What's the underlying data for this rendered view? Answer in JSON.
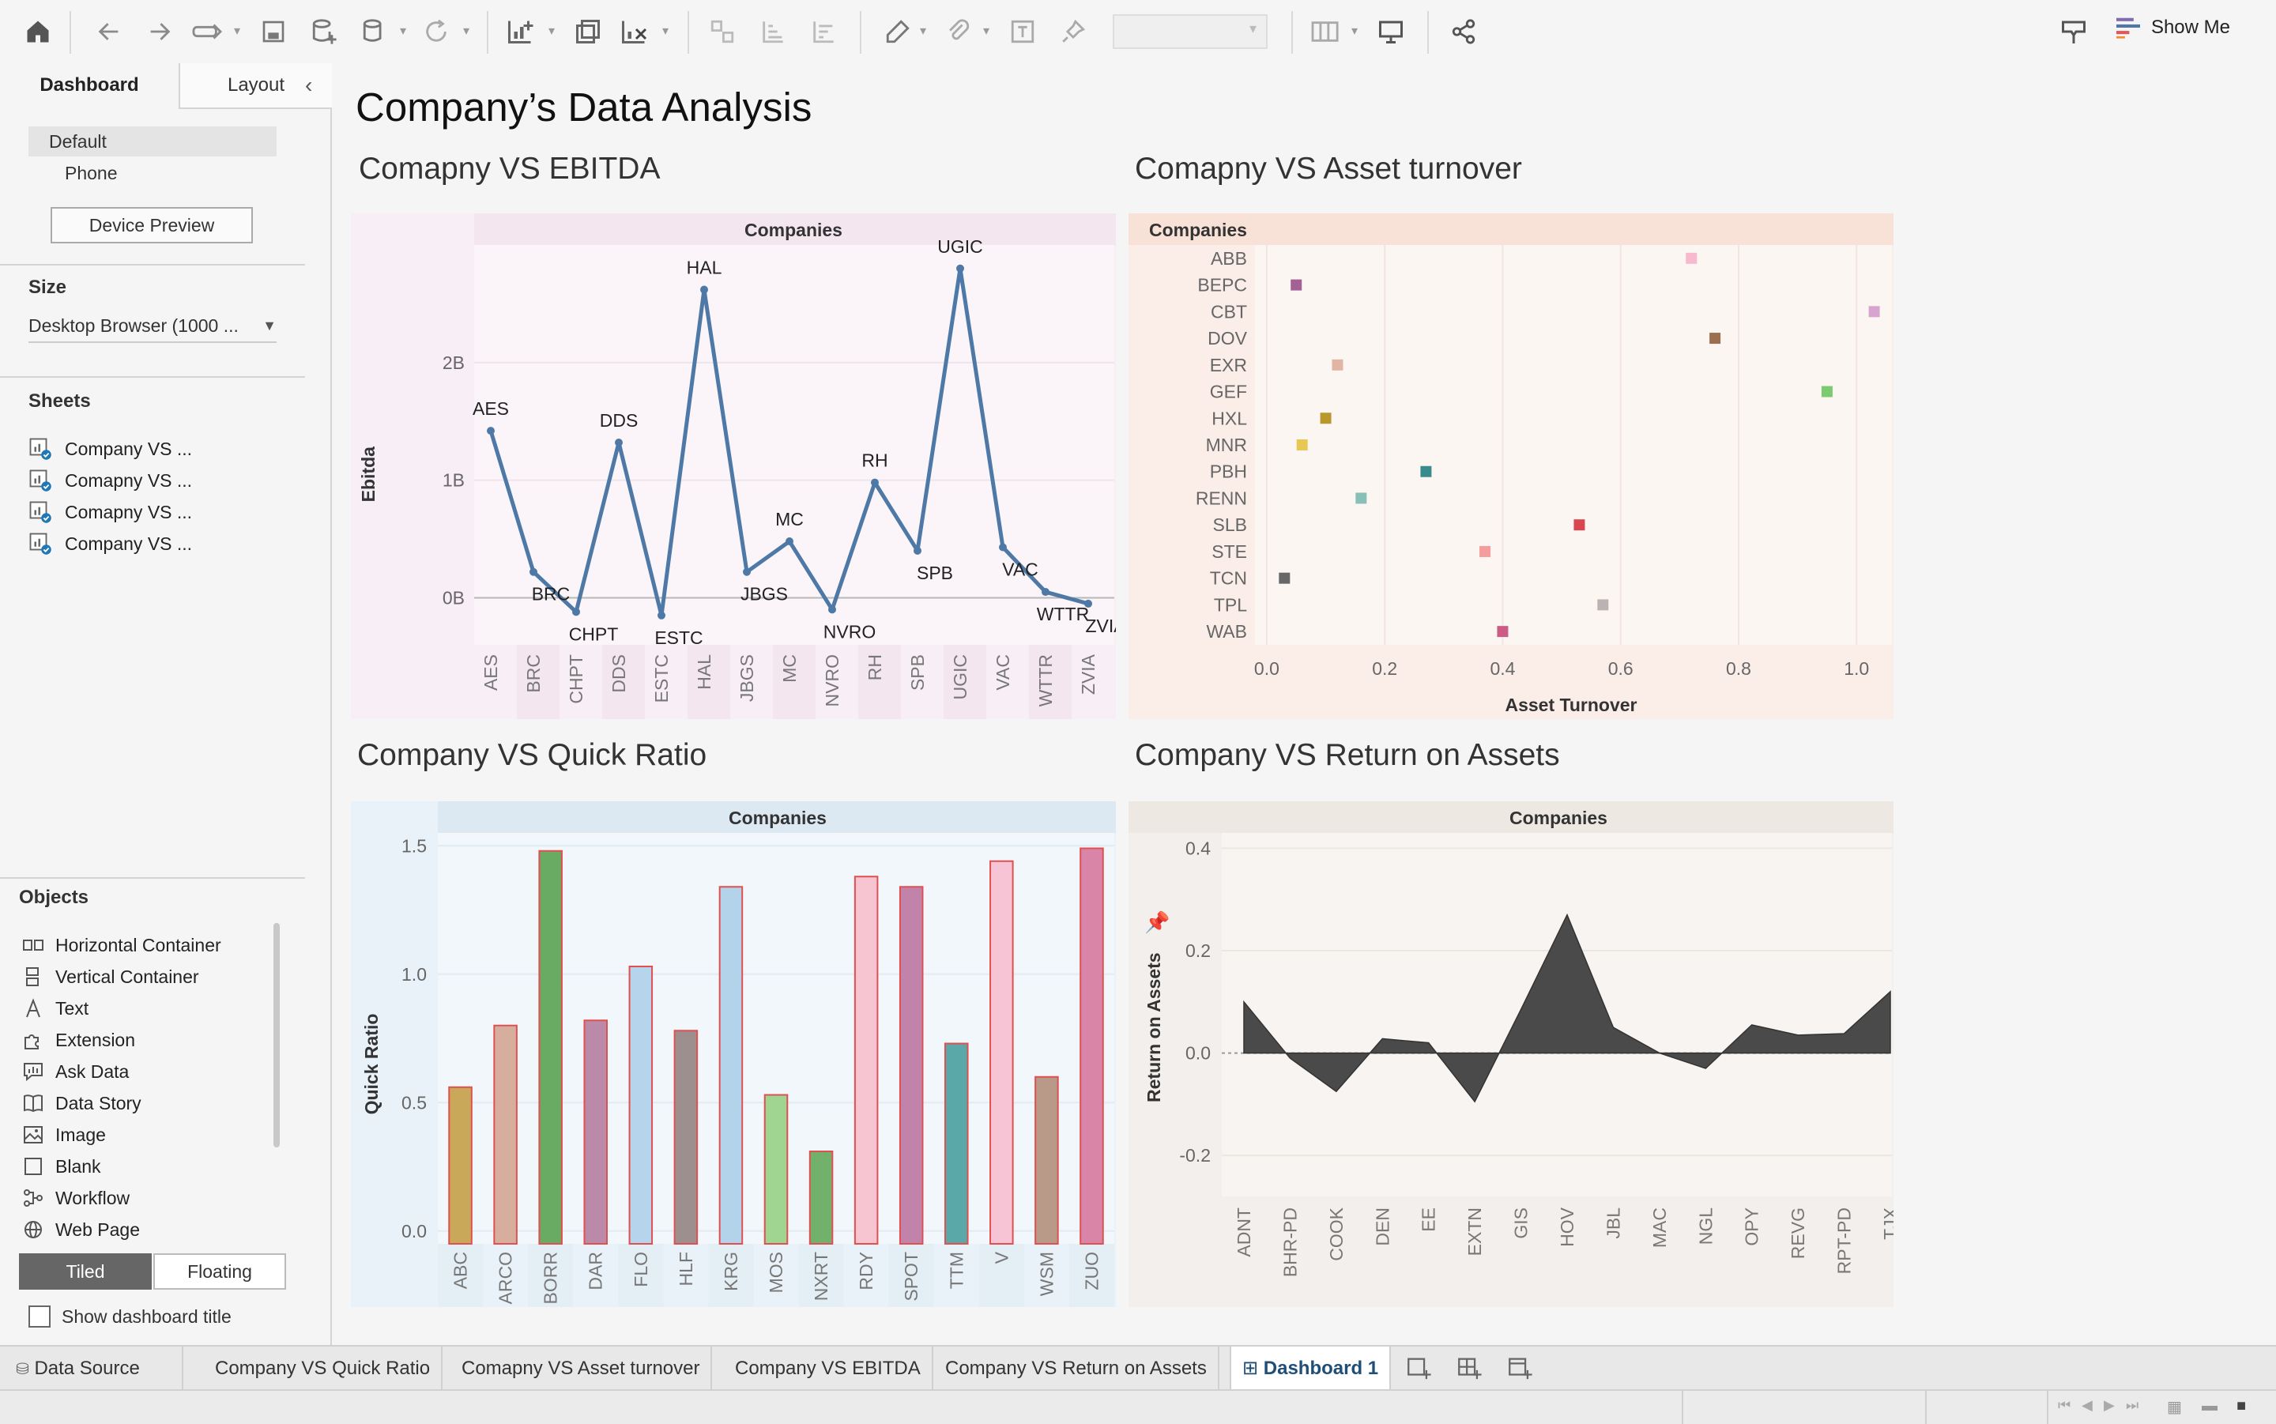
{
  "toolbar": {
    "show_me": "Show Me"
  },
  "sidebar": {
    "tab_dashboard": "Dashboard",
    "tab_layout": "Layout",
    "device_default": "Default",
    "device_phone": "Phone",
    "device_preview_button": "Device Preview",
    "size_title": "Size",
    "size_value": "Desktop Browser (1000 ...",
    "sheets_title": "Sheets",
    "sheets": [
      "Company VS ...",
      "Comapny VS ...",
      "Comapny VS ...",
      "Company VS ..."
    ],
    "objects_title": "Objects",
    "objects": [
      "Horizontal Container",
      "Vertical Container",
      "Text",
      "Extension",
      "Ask Data",
      "Data Story",
      "Image",
      "Blank",
      "Workflow",
      "Web Page"
    ],
    "tiled": "Tiled",
    "floating": "Floating",
    "show_title": "Show dashboard title"
  },
  "dashboard": {
    "title": "Company’s Data Analysis",
    "panel1_title": "Comapny VS EBITDA",
    "panel2_title": "Comapny VS Asset turnover",
    "panel3_title": "Company VS Quick Ratio",
    "panel4_title": "Company VS Return on Assets"
  },
  "bottom_tabs": [
    "Data Source",
    "Company VS Quick Ratio",
    "Comapny VS Asset turnover",
    "Company VS EBITDA",
    "Company VS Return on Assets",
    "Dashboard 1"
  ],
  "colors": {
    "line": "#4e79a7",
    "area": "#4a4a4a",
    "ebitda_bg": "#f8eef5",
    "turnover_bg": "#fbeee8",
    "quick_bg": "#e9f2f8",
    "roa_bg": "#f3efec"
  },
  "chart_data": [
    {
      "type": "line",
      "column_header": "Companies",
      "ylabel": "Ebitda",
      "yticks": [
        "0B",
        "1B",
        "2B"
      ],
      "ylim": [
        -0.4,
        3.0
      ],
      "categories": [
        "AES",
        "BRC",
        "CHPT",
        "DDS",
        "ESTC",
        "HAL",
        "JBGS",
        "MC",
        "NVRO",
        "RH",
        "SPB",
        "UGIC",
        "VAC",
        "WTTR",
        "ZVIA"
      ],
      "values": [
        1.42,
        0.22,
        -0.12,
        1.32,
        -0.15,
        2.62,
        0.22,
        0.48,
        -0.1,
        0.98,
        0.4,
        2.8,
        0.43,
        0.05,
        -0.05
      ]
    },
    {
      "type": "scatter",
      "column_header": "Companies",
      "xlabel": "Asset Turnover",
      "xticks": [
        "0.0",
        "0.2",
        "0.4",
        "0.6",
        "0.8",
        "1.0"
      ],
      "xlim": [
        -0.02,
        1.06
      ],
      "categories": [
        "ABB",
        "BEPC",
        "CBT",
        "DOV",
        "EXR",
        "GEF",
        "HXL",
        "MNR",
        "PBH",
        "RENN",
        "SLB",
        "STE",
        "TCN",
        "TPL",
        "WAB"
      ],
      "values": [
        0.72,
        0.05,
        1.03,
        0.76,
        0.12,
        0.95,
        0.1,
        0.06,
        0.27,
        0.16,
        0.53,
        0.37,
        0.03,
        0.57,
        0.4
      ],
      "colors": [
        "#f8b9d0",
        "#a36196",
        "#d7a4cf",
        "#9c6f4f",
        "#e1b4a4",
        "#7dcb71",
        "#b8982c",
        "#e8c854",
        "#3a8b8b",
        "#86c0b8",
        "#d8474f",
        "#f59c9c",
        "#676767",
        "#bbb3b3",
        "#cc5b86"
      ]
    },
    {
      "type": "bar",
      "column_header": "Companies",
      "ylabel": "Quick Ratio",
      "yticks": [
        "0.0",
        "0.5",
        "1.0",
        "1.5"
      ],
      "ylim": [
        -0.05,
        1.55
      ],
      "categories": [
        "ABC",
        "ARCO",
        "BORR",
        "DAR",
        "FLO",
        "HLF",
        "KRG",
        "MOS",
        "NXRT",
        "RDY",
        "SPOT",
        "TTM",
        "V",
        "WSM",
        "ZUO"
      ],
      "values": [
        0.56,
        0.8,
        1.48,
        0.82,
        1.03,
        0.78,
        1.34,
        0.53,
        0.31,
        1.38,
        1.34,
        0.73,
        1.44,
        0.6,
        1.49
      ],
      "colors": [
        "#c9a85a",
        "#d7ae9e",
        "#6aab64",
        "#bb8aa8",
        "#b6d4ec",
        "#9e8f8f",
        "#b3d3ea",
        "#9fd591",
        "#72b16c",
        "#f7c4d2",
        "#c283ab",
        "#5aa8a8",
        "#f7c4d5",
        "#b99987",
        "#d885a8"
      ]
    },
    {
      "type": "area",
      "column_header": "Companies",
      "ylabel": "Return on Assets",
      "yticks": [
        "-0.2",
        "0.0",
        "0.2",
        "0.4"
      ],
      "ylim": [
        -0.28,
        0.43
      ],
      "categories": [
        "ADNT",
        "BHR-PD",
        "COOK",
        "DEN",
        "EE",
        "EXTN",
        "GIS",
        "HOV",
        "JBL",
        "MAC",
        "NGL",
        "OPY",
        "REVG",
        "RPT-PD",
        "TJX"
      ],
      "values": [
        0.1,
        -0.01,
        -0.075,
        0.028,
        0.02,
        -0.095,
        0.085,
        0.27,
        0.05,
        0.0,
        -0.03,
        0.055,
        0.035,
        0.038,
        0.12
      ]
    }
  ]
}
